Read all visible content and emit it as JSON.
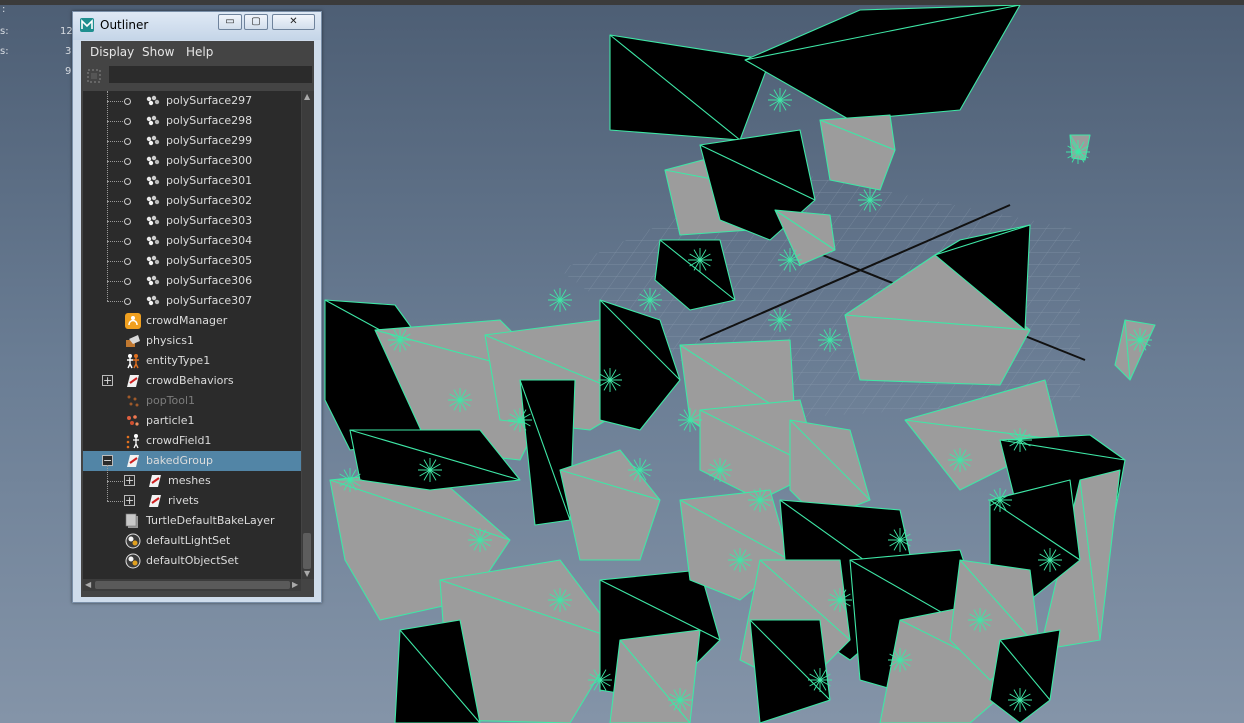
{
  "window": {
    "title": "Outliner",
    "controls": {
      "minimize": "▭",
      "maximize": "▢",
      "close": "✕"
    }
  },
  "menu": [
    "Display",
    "Show",
    "Help"
  ],
  "filter": {
    "value": "",
    "placeholder": ""
  },
  "hud_labels": [
    ":",
    "s:",
    "s:"
  ],
  "hud_values": [
    "12",
    "3",
    "9"
  ],
  "tree_items": [
    {
      "label": "polySurface297",
      "icon": "mesh-icon",
      "depth": 1
    },
    {
      "label": "polySurface298",
      "icon": "mesh-icon",
      "depth": 1
    },
    {
      "label": "polySurface299",
      "icon": "mesh-icon",
      "depth": 1
    },
    {
      "label": "polySurface300",
      "icon": "mesh-icon",
      "depth": 1
    },
    {
      "label": "polySurface301",
      "icon": "mesh-icon",
      "depth": 1
    },
    {
      "label": "polySurface302",
      "icon": "mesh-icon",
      "depth": 1
    },
    {
      "label": "polySurface303",
      "icon": "mesh-icon",
      "depth": 1
    },
    {
      "label": "polySurface304",
      "icon": "mesh-icon",
      "depth": 1
    },
    {
      "label": "polySurface305",
      "icon": "mesh-icon",
      "depth": 1
    },
    {
      "label": "polySurface306",
      "icon": "mesh-icon",
      "depth": 1
    },
    {
      "label": "polySurface307",
      "icon": "mesh-icon",
      "depth": 1
    },
    {
      "label": "crowdManager",
      "icon": "crowd-manager-icon",
      "depth": 0
    },
    {
      "label": "physics1",
      "icon": "physics-icon",
      "depth": 0
    },
    {
      "label": "entityType1",
      "icon": "entity-type-icon",
      "depth": 0
    },
    {
      "label": "crowdBehaviors",
      "icon": "group-icon",
      "depth": 0,
      "expand": "+"
    },
    {
      "label": "popTool1",
      "icon": "pop-tool-icon",
      "depth": 0,
      "dim": true
    },
    {
      "label": "particle1",
      "icon": "particle-icon",
      "depth": 0
    },
    {
      "label": "crowdField1",
      "icon": "crowd-field-icon",
      "depth": 0
    },
    {
      "label": "bakedGroup",
      "icon": "group-icon",
      "depth": 0,
      "expand": "−",
      "selected": true
    },
    {
      "label": "meshes",
      "icon": "group-icon",
      "depth": 1,
      "expand": "+"
    },
    {
      "label": "rivets",
      "icon": "group-icon",
      "depth": 1,
      "expand": "+"
    },
    {
      "label": "TurtleDefaultBakeLayer",
      "icon": "bake-layer-icon",
      "depth": 0
    },
    {
      "label": "defaultLightSet",
      "icon": "set-icon",
      "depth": 0
    },
    {
      "label": "defaultObjectSet",
      "icon": "set-icon",
      "depth": 0
    }
  ],
  "colors": {
    "viewport_bg": "#5d6f86",
    "wireframe": "#3ee7a6",
    "selection": "#5285a6",
    "crowd_manager": "#f0a020"
  }
}
